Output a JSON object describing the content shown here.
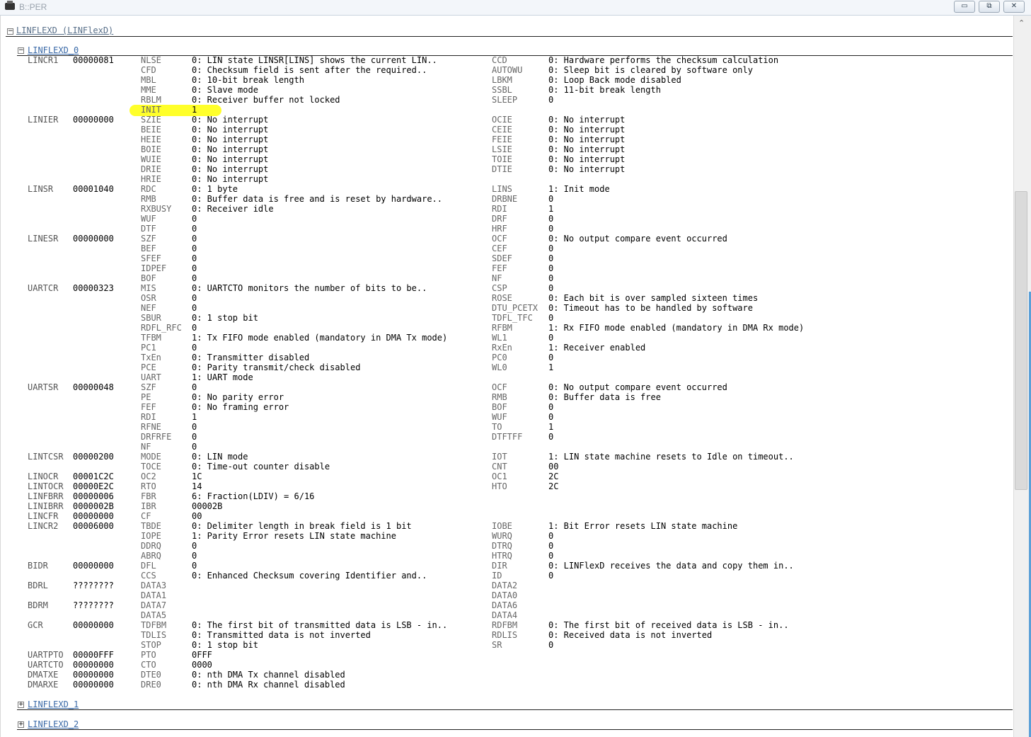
{
  "window": {
    "title": "B::PER",
    "minimize_glyph": "▭",
    "restore_glyph": "⧉",
    "close_glyph": "✕"
  },
  "scrollbar": {
    "up_glyph": "⌃"
  },
  "tree": {
    "root": {
      "label": "LINFLEXD (LINFlexD)",
      "toggle": "−"
    },
    "sub0": {
      "label": "LINFLEXD_0",
      "toggle": "−"
    },
    "sub1": {
      "label": "LINFLEXD_1",
      "toggle": "+"
    },
    "sub2": {
      "label": "LINFLEXD_2",
      "toggle": "+"
    }
  },
  "highlight": {
    "color": "#ffff2a",
    "field": "INIT"
  },
  "rows": [
    {
      "reg": "LINCR1",
      "hex": "00000081",
      "lf": "NLSE",
      "lv": "0: LIN state LINSR[LINS] shows the current LIN..",
      "rf": "CCD",
      "rv": "0: Hardware performs the checksum calculation"
    },
    {
      "reg": "",
      "hex": "",
      "lf": "CFD",
      "lv": "0: Checksum field is sent after the required..",
      "rf": "AUTOWU",
      "rv": "0: Sleep bit is cleared by software only"
    },
    {
      "reg": "",
      "hex": "",
      "lf": "MBL",
      "lv": "0: 10-bit break length",
      "rf": "LBKM",
      "rv": "0: Loop Back mode disabled"
    },
    {
      "reg": "",
      "hex": "",
      "lf": "MME",
      "lv": "0: Slave mode",
      "rf": "SSBL",
      "rv": "0: 11-bit break length"
    },
    {
      "reg": "",
      "hex": "",
      "lf": "RBLM",
      "lv": "0: Receiver buffer not locked",
      "rf": "SLEEP",
      "rv": "0"
    },
    {
      "reg": "",
      "hex": "",
      "lf": "INIT",
      "lv": "1",
      "rf": "",
      "rv": ""
    },
    {
      "reg": "LINIER",
      "hex": "00000000",
      "lf": "SZIE",
      "lv": "0: No interrupt",
      "rf": "OCIE",
      "rv": "0: No interrupt"
    },
    {
      "reg": "",
      "hex": "",
      "lf": "BEIE",
      "lv": "0: No interrupt",
      "rf": "CEIE",
      "rv": "0: No interrupt"
    },
    {
      "reg": "",
      "hex": "",
      "lf": "HEIE",
      "lv": "0: No interrupt",
      "rf": "FEIE",
      "rv": "0: No interrupt"
    },
    {
      "reg": "",
      "hex": "",
      "lf": "BOIE",
      "lv": "0: No interrupt",
      "rf": "LSIE",
      "rv": "0: No interrupt"
    },
    {
      "reg": "",
      "hex": "",
      "lf": "WUIE",
      "lv": "0: No interrupt",
      "rf": "TOIE",
      "rv": "0: No interrupt"
    },
    {
      "reg": "",
      "hex": "",
      "lf": "DRIE",
      "lv": "0: No interrupt",
      "rf": "DTIE",
      "rv": "0: No interrupt"
    },
    {
      "reg": "",
      "hex": "",
      "lf": "HRIE",
      "lv": "0: No interrupt",
      "rf": "",
      "rv": ""
    },
    {
      "reg": "LINSR",
      "hex": "00001040",
      "lf": "RDC",
      "lv": "0: 1 byte",
      "rf": "LINS",
      "rv": "1: Init mode"
    },
    {
      "reg": "",
      "hex": "",
      "lf": "RMB",
      "lv": "0: Buffer data is free and is reset by hardware..",
      "rf": "DRBNE",
      "rv": "0"
    },
    {
      "reg": "",
      "hex": "",
      "lf": "RXBUSY",
      "lv": "0: Receiver idle",
      "rf": "RDI",
      "rv": "1"
    },
    {
      "reg": "",
      "hex": "",
      "lf": "WUF",
      "lv": "0",
      "rf": "DRF",
      "rv": "0"
    },
    {
      "reg": "",
      "hex": "",
      "lf": "DTF",
      "lv": "0",
      "rf": "HRF",
      "rv": "0"
    },
    {
      "reg": "LINESR",
      "hex": "00000000",
      "lf": "SZF",
      "lv": "0",
      "rf": "OCF",
      "rv": "0: No output compare event occurred"
    },
    {
      "reg": "",
      "hex": "",
      "lf": "BEF",
      "lv": "0",
      "rf": "CEF",
      "rv": "0"
    },
    {
      "reg": "",
      "hex": "",
      "lf": "SFEF",
      "lv": "0",
      "rf": "SDEF",
      "rv": "0"
    },
    {
      "reg": "",
      "hex": "",
      "lf": "IDPEF",
      "lv": "0",
      "rf": "FEF",
      "rv": "0"
    },
    {
      "reg": "",
      "hex": "",
      "lf": "BOF",
      "lv": "0",
      "rf": "NF",
      "rv": "0"
    },
    {
      "reg": "UARTCR",
      "hex": "00000323",
      "lf": "MIS",
      "lv": "0: UARTCTO monitors the number of bits to be..",
      "rf": "CSP",
      "rv": "0"
    },
    {
      "reg": "",
      "hex": "",
      "lf": "OSR",
      "lv": "0",
      "rf": "ROSE",
      "rv": "0: Each bit is over sampled sixteen times"
    },
    {
      "reg": "",
      "hex": "",
      "lf": "NEF",
      "lv": "0",
      "rf": "DTU_PCETX",
      "rv": "0: Timeout has to be handled by software"
    },
    {
      "reg": "",
      "hex": "",
      "lf": "SBUR",
      "lv": "0: 1 stop bit",
      "rf": "TDFL_TFC",
      "rv": "0"
    },
    {
      "reg": "",
      "hex": "",
      "lf": "RDFL_RFC",
      "lv": "0",
      "rf": "RFBM",
      "rv": "1: Rx FIFO mode enabled (mandatory in DMA Rx mode)"
    },
    {
      "reg": "",
      "hex": "",
      "lf": "TFBM",
      "lv": "1: Tx FIFO mode enabled (mandatory in DMA Tx mode)",
      "rf": "WL1",
      "rv": "0"
    },
    {
      "reg": "",
      "hex": "",
      "lf": "PC1",
      "lv": "0",
      "rf": "RxEn",
      "rv": "1: Receiver enabled"
    },
    {
      "reg": "",
      "hex": "",
      "lf": "TxEn",
      "lv": "0: Transmitter disabled",
      "rf": "PC0",
      "rv": "0"
    },
    {
      "reg": "",
      "hex": "",
      "lf": "PCE",
      "lv": "0: Parity transmit/check disabled",
      "rf": "WL0",
      "rv": "1"
    },
    {
      "reg": "",
      "hex": "",
      "lf": "UART",
      "lv": "1: UART mode",
      "rf": "",
      "rv": ""
    },
    {
      "reg": "UARTSR",
      "hex": "00000048",
      "lf": "SZF",
      "lv": "0",
      "rf": "OCF",
      "rv": "0: No output compare event occurred"
    },
    {
      "reg": "",
      "hex": "",
      "lf": "PE",
      "lv": "0: No parity error",
      "rf": "RMB",
      "rv": "0: Buffer data is free"
    },
    {
      "reg": "",
      "hex": "",
      "lf": "FEF",
      "lv": "0: No framing error",
      "rf": "BOF",
      "rv": "0"
    },
    {
      "reg": "",
      "hex": "",
      "lf": "RDI",
      "lv": "1",
      "rf": "WUF",
      "rv": "0"
    },
    {
      "reg": "",
      "hex": "",
      "lf": "RFNE",
      "lv": "0",
      "rf": "TO",
      "rv": "1"
    },
    {
      "reg": "",
      "hex": "",
      "lf": "DRFRFE",
      "lv": "0",
      "rf": "DTFTFF",
      "rv": "0"
    },
    {
      "reg": "",
      "hex": "",
      "lf": "NF",
      "lv": "0",
      "rf": "",
      "rv": ""
    },
    {
      "reg": "LINTCSR",
      "hex": "00000200",
      "lf": "MODE",
      "lv": "0: LIN mode",
      "rf": "IOT",
      "rv": "1: LIN state machine resets to Idle on timeout.."
    },
    {
      "reg": "",
      "hex": "",
      "lf": "TOCE",
      "lv": "0: Time-out counter disable",
      "rf": "CNT",
      "rv": "00"
    },
    {
      "reg": "LINOCR",
      "hex": "00001C2C",
      "lf": "OC2",
      "lv": "1C",
      "rf": "OC1",
      "rv": "2C"
    },
    {
      "reg": "LINTOCR",
      "hex": "00000E2C",
      "lf": "RTO",
      "lv": "14",
      "rf": "HTO",
      "rv": "2C"
    },
    {
      "reg": "LINFBRR",
      "hex": "00000006",
      "lf": "FBR",
      "lv": "6: Fraction(LDIV) = 6/16",
      "rf": "",
      "rv": ""
    },
    {
      "reg": "LINIBRR",
      "hex": "0000002B",
      "lf": "IBR",
      "lv": "00002B",
      "rf": "",
      "rv": ""
    },
    {
      "reg": "LINCFR",
      "hex": "00000000",
      "lf": "CF",
      "lv": "00",
      "rf": "",
      "rv": ""
    },
    {
      "reg": "LINCR2",
      "hex": "00006000",
      "lf": "TBDE",
      "lv": "0: Delimiter length in break field is 1 bit",
      "rf": "IOBE",
      "rv": "1: Bit Error resets LIN state machine"
    },
    {
      "reg": "",
      "hex": "",
      "lf": "IOPE",
      "lv": "1: Parity Error resets LIN state machine",
      "rf": "WURQ",
      "rv": "0"
    },
    {
      "reg": "",
      "hex": "",
      "lf": "DDRQ",
      "lv": "0",
      "rf": "DTRQ",
      "rv": "0"
    },
    {
      "reg": "",
      "hex": "",
      "lf": "ABRQ",
      "lv": "0",
      "rf": "HTRQ",
      "rv": "0"
    },
    {
      "reg": "BIDR",
      "hex": "00000000",
      "lf": "DFL",
      "lv": "0",
      "rf": "DIR",
      "rv": "0: LINFlexD receives the data and copy them in.."
    },
    {
      "reg": "",
      "hex": "",
      "lf": "CCS",
      "lv": "0: Enhanced Checksum covering Identifier and..",
      "rf": "ID",
      "rv": "0"
    },
    {
      "reg": "BDRL",
      "hex": "????????",
      "lf": "DATA3",
      "lv": "",
      "rf": "DATA2",
      "rv": ""
    },
    {
      "reg": "",
      "hex": "",
      "lf": "DATA1",
      "lv": "",
      "rf": "DATA0",
      "rv": ""
    },
    {
      "reg": "BDRM",
      "hex": "????????",
      "lf": "DATA7",
      "lv": "",
      "rf": "DATA6",
      "rv": ""
    },
    {
      "reg": "",
      "hex": "",
      "lf": "DATA5",
      "lv": "",
      "rf": "DATA4",
      "rv": ""
    },
    {
      "reg": "GCR",
      "hex": "00000000",
      "lf": "TDFBM",
      "lv": "0: The first bit of transmitted data is LSB - in..",
      "rf": "RDFBM",
      "rv": "0: The first bit of received data is LSB - in.."
    },
    {
      "reg": "",
      "hex": "",
      "lf": "TDLIS",
      "lv": "0: Transmitted data is not inverted",
      "rf": "RDLIS",
      "rv": "0: Received data is not inverted"
    },
    {
      "reg": "",
      "hex": "",
      "lf": "STOP",
      "lv": "0: 1 stop bit",
      "rf": "SR",
      "rv": "0"
    },
    {
      "reg": "UARTPTO",
      "hex": "00000FFF",
      "lf": "PTO",
      "lv": "0FFF",
      "rf": "",
      "rv": ""
    },
    {
      "reg": "UARTCTO",
      "hex": "00000000",
      "lf": "CTO",
      "lv": "0000",
      "rf": "",
      "rv": ""
    },
    {
      "reg": "DMATXE",
      "hex": "00000000",
      "lf": "DTE0",
      "lv": "0: nth DMA Tx channel disabled",
      "rf": "",
      "rv": ""
    },
    {
      "reg": "DMARXE",
      "hex": "00000000",
      "lf": "DRE0",
      "lv": "0: nth DMA Rx channel disabled",
      "rf": "",
      "rv": ""
    }
  ]
}
